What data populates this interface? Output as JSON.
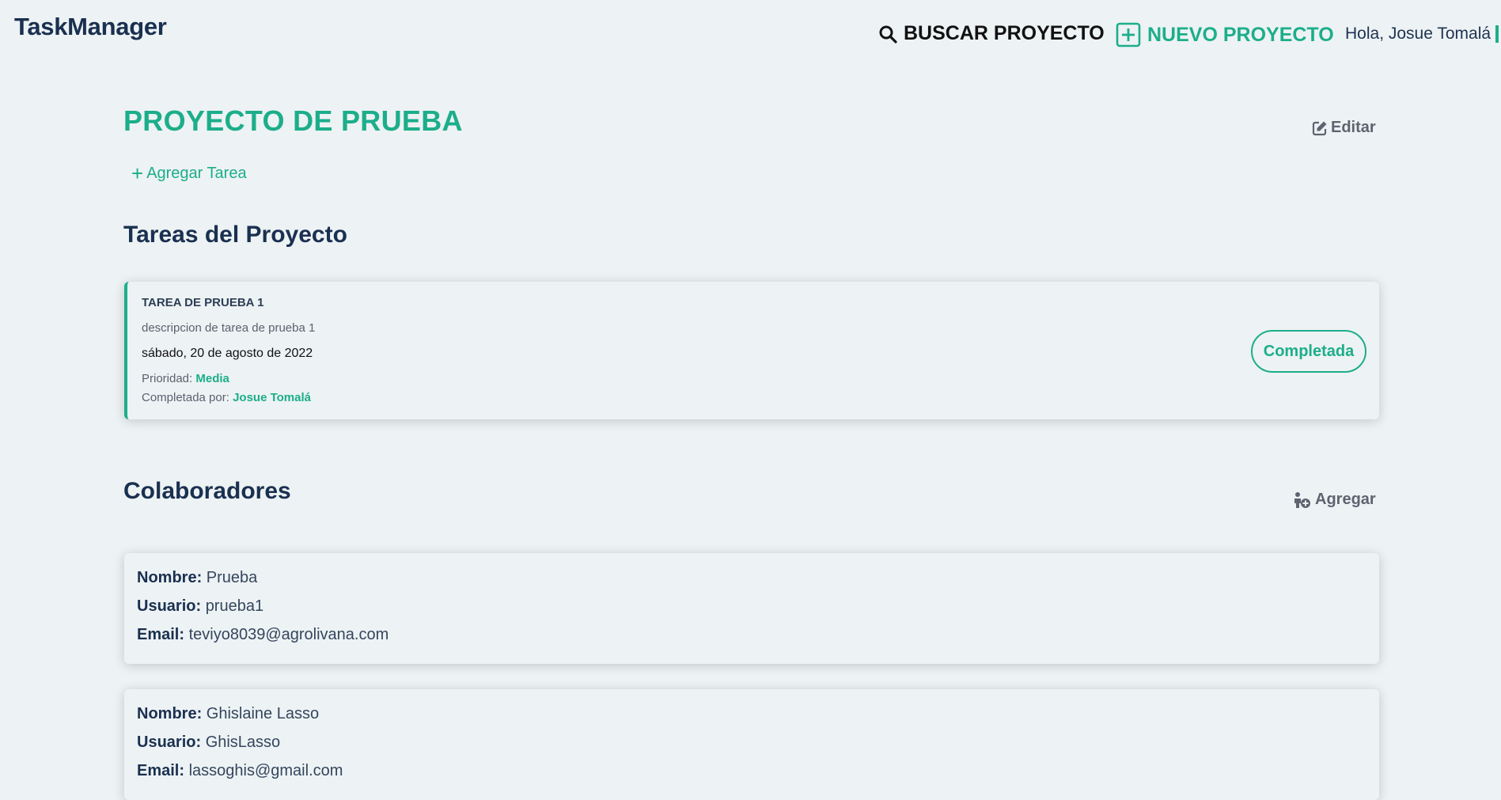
{
  "app": {
    "brand": "TaskManager"
  },
  "nav": {
    "search_label": "BUSCAR PROYECTO",
    "new_project_label": "NUEVO PROYECTO",
    "greeting": "Hola, Josue Tomalá"
  },
  "project": {
    "title": "PROYECTO DE PRUEBA",
    "edit_label": "Editar",
    "add_task_label": "Agregar Tarea"
  },
  "tasks_section": {
    "title": "Tareas del Proyecto"
  },
  "tasks": [
    {
      "name": "TAREA DE PRUEBA 1",
      "description": "descripcion de tarea de prueba 1",
      "date": "sábado, 20 de agosto de 2022",
      "priority_label": "Prioridad:",
      "priority": "Media",
      "completed_by_label": "Completada por:",
      "completed_by": "Josue Tomalá",
      "status": "Completada"
    }
  ],
  "collaborators_section": {
    "title": "Colaboradores",
    "add_label": "Agregar"
  },
  "labels": {
    "name": "Nombre:",
    "user": "Usuario:",
    "email": "Email:"
  },
  "collaborators": [
    {
      "name": "Prueba",
      "user": "prueba1",
      "email": "teviyo8039@agrolivana.com"
    },
    {
      "name": "Ghislaine Lasso",
      "user": "GhisLasso",
      "email": "lassoghis@gmail.com"
    }
  ],
  "colors": {
    "accent": "#1cae8a",
    "navy": "#1a3050",
    "background": "#edf2f4"
  },
  "icons": [
    "search-icon",
    "plus-square-icon",
    "edit-icon",
    "plus-icon",
    "user-plus-icon"
  ]
}
